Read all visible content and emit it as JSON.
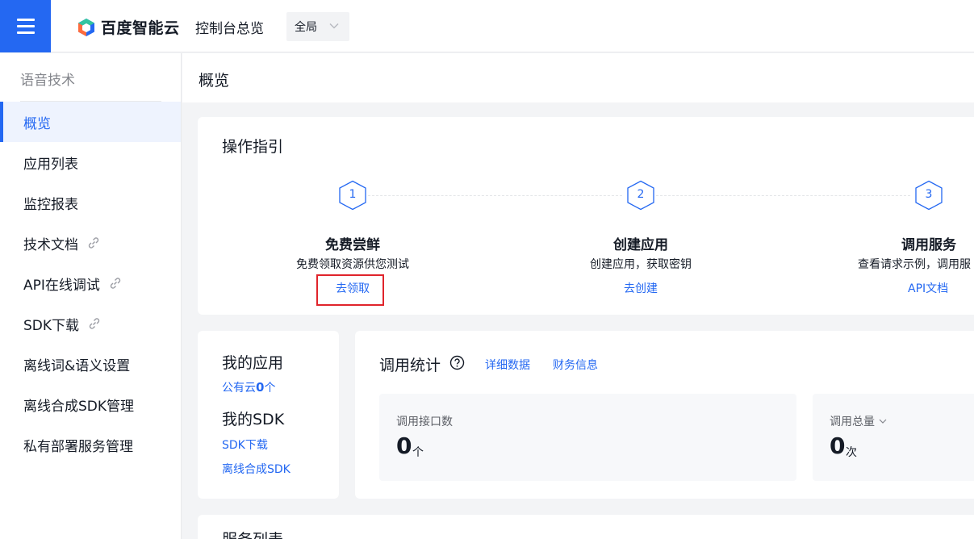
{
  "header": {
    "brand": "百度智能云",
    "console": "控制台总览",
    "region": "全局"
  },
  "sidebar": {
    "title": "语音技术",
    "items": [
      {
        "label": "概览",
        "active": true,
        "external": false
      },
      {
        "label": "应用列表",
        "active": false,
        "external": false
      },
      {
        "label": "监控报表",
        "active": false,
        "external": false
      },
      {
        "label": "技术文档",
        "active": false,
        "external": true
      },
      {
        "label": "API在线调试",
        "active": false,
        "external": true
      },
      {
        "label": "SDK下载",
        "active": false,
        "external": true
      },
      {
        "label": "离线词&语义设置",
        "active": false,
        "external": false
      },
      {
        "label": "离线合成SDK管理",
        "active": false,
        "external": false
      },
      {
        "label": "私有部署服务管理",
        "active": false,
        "external": false
      }
    ]
  },
  "page": {
    "title": "概览"
  },
  "guide": {
    "title": "操作指引",
    "steps": [
      {
        "num": "1",
        "name": "免费尝鲜",
        "desc": "免费领取资源供您测试",
        "link": "去领取"
      },
      {
        "num": "2",
        "name": "创建应用",
        "desc": "创建应用，获取密钥",
        "link": "去创建"
      },
      {
        "num": "3",
        "name": "调用服务",
        "desc": "查看请求示例，调用服",
        "link": "API文档"
      }
    ]
  },
  "apps": {
    "my_apps_title": "我的应用",
    "public_cloud_prefix": "公有云",
    "public_cloud_count": "0",
    "public_cloud_unit": "个",
    "my_sdk_title": "我的SDK",
    "sdk_download": "SDK下载",
    "offline_sdk": "离线合成SDK"
  },
  "stats": {
    "title": "调用统计",
    "detail_link": "详细数据",
    "finance_link": "财务信息",
    "api_count_label": "调用接口数",
    "api_count_value": "0",
    "api_count_unit": "个",
    "total_label": "调用总量",
    "total_value": "0",
    "total_unit": "次"
  },
  "services": {
    "title": "服务列表"
  },
  "colors": {
    "primary": "#2468f2",
    "highlight": "#e0242b"
  }
}
